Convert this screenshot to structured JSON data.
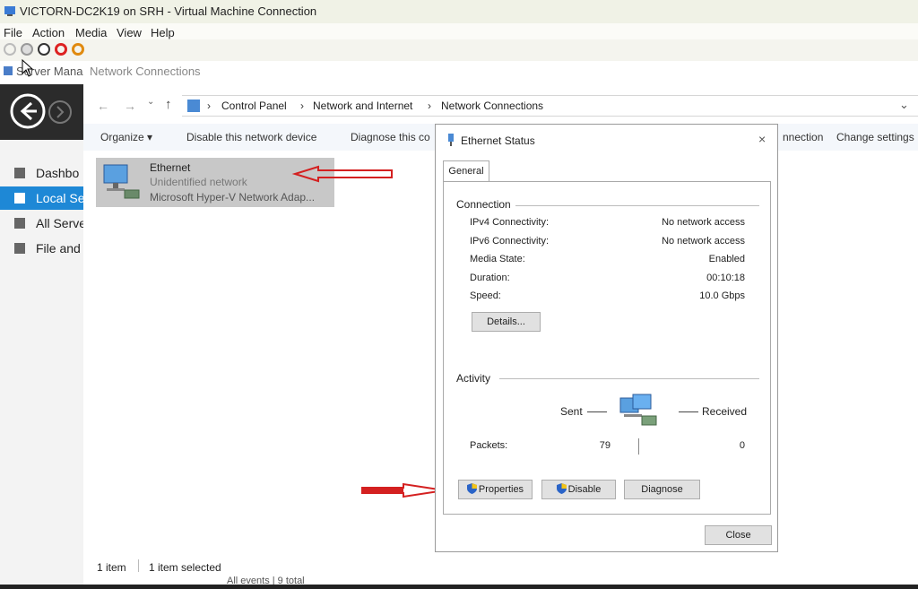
{
  "vm": {
    "title": "VICTORN-DC2K19 on SRH - Virtual Machine Connection",
    "menu": [
      "File",
      "Action",
      "Media",
      "View",
      "Help"
    ]
  },
  "server_manager": {
    "header": "Server Manag",
    "sidebar": [
      {
        "label": "Dashbo",
        "icon": "dashboard-icon"
      },
      {
        "label": "Local Se",
        "icon": "local-server-icon"
      },
      {
        "label": "All Serve",
        "icon": "all-servers-icon"
      },
      {
        "label": "File and",
        "icon": "file-storage-icon"
      }
    ],
    "events_text": "All events | 9 total"
  },
  "explorer": {
    "title": "Network Connections",
    "breadcrumb": [
      "Control Panel",
      "Network and Internet",
      "Network Connections"
    ],
    "commands": [
      "Organize ▾",
      "Disable this network device",
      "Diagnose this co",
      "nnection",
      "Change settings"
    ],
    "adapter": {
      "name": "Ethernet",
      "status": "Unidentified network",
      "device": "Microsoft Hyper-V Network Adap..."
    },
    "status_bar": {
      "count": "1 item",
      "selected": "1 item selected"
    }
  },
  "dialog": {
    "title": "Ethernet Status",
    "tab": "General",
    "connection_label": "Connection",
    "rows": [
      {
        "label": "IPv4 Connectivity:",
        "value": "No network access"
      },
      {
        "label": "IPv6 Connectivity:",
        "value": "No network access"
      },
      {
        "label": "Media State:",
        "value": "Enabled"
      },
      {
        "label": "Duration:",
        "value": "00:10:18"
      },
      {
        "label": "Speed:",
        "value": "10.0 Gbps"
      }
    ],
    "details_button": "Details...",
    "activity_label": "Activity",
    "sent_label": "Sent",
    "received_label": "Received",
    "packets_label": "Packets:",
    "packets_sent": "79",
    "packets_received": "0",
    "properties_button": "Properties",
    "disable_button": "Disable",
    "diagnose_button": "Diagnose",
    "close_button": "Close"
  },
  "colors": {
    "annotation": "#d42020",
    "selection": "#c8c8c8",
    "nav_dark": "#2b2b2b"
  }
}
